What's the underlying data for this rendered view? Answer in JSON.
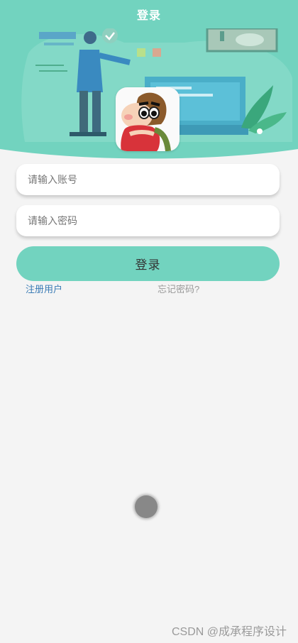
{
  "header": {
    "title": "登录"
  },
  "login_form": {
    "account_placeholder": "请输入账号",
    "password_placeholder": "请输入密码",
    "submit_label": "登录",
    "register_link": "注册用户",
    "forgot_link": "忘记密码?"
  },
  "watermark": "CSDN @成承程序设计",
  "colors": {
    "accent": "#72d3bf",
    "background": "#f4f4f4",
    "link": "#3a7bb5",
    "muted_text": "#999999"
  },
  "icons": {
    "avatar": "cartoon-boy-avatar",
    "loading": "loading-spinner"
  }
}
